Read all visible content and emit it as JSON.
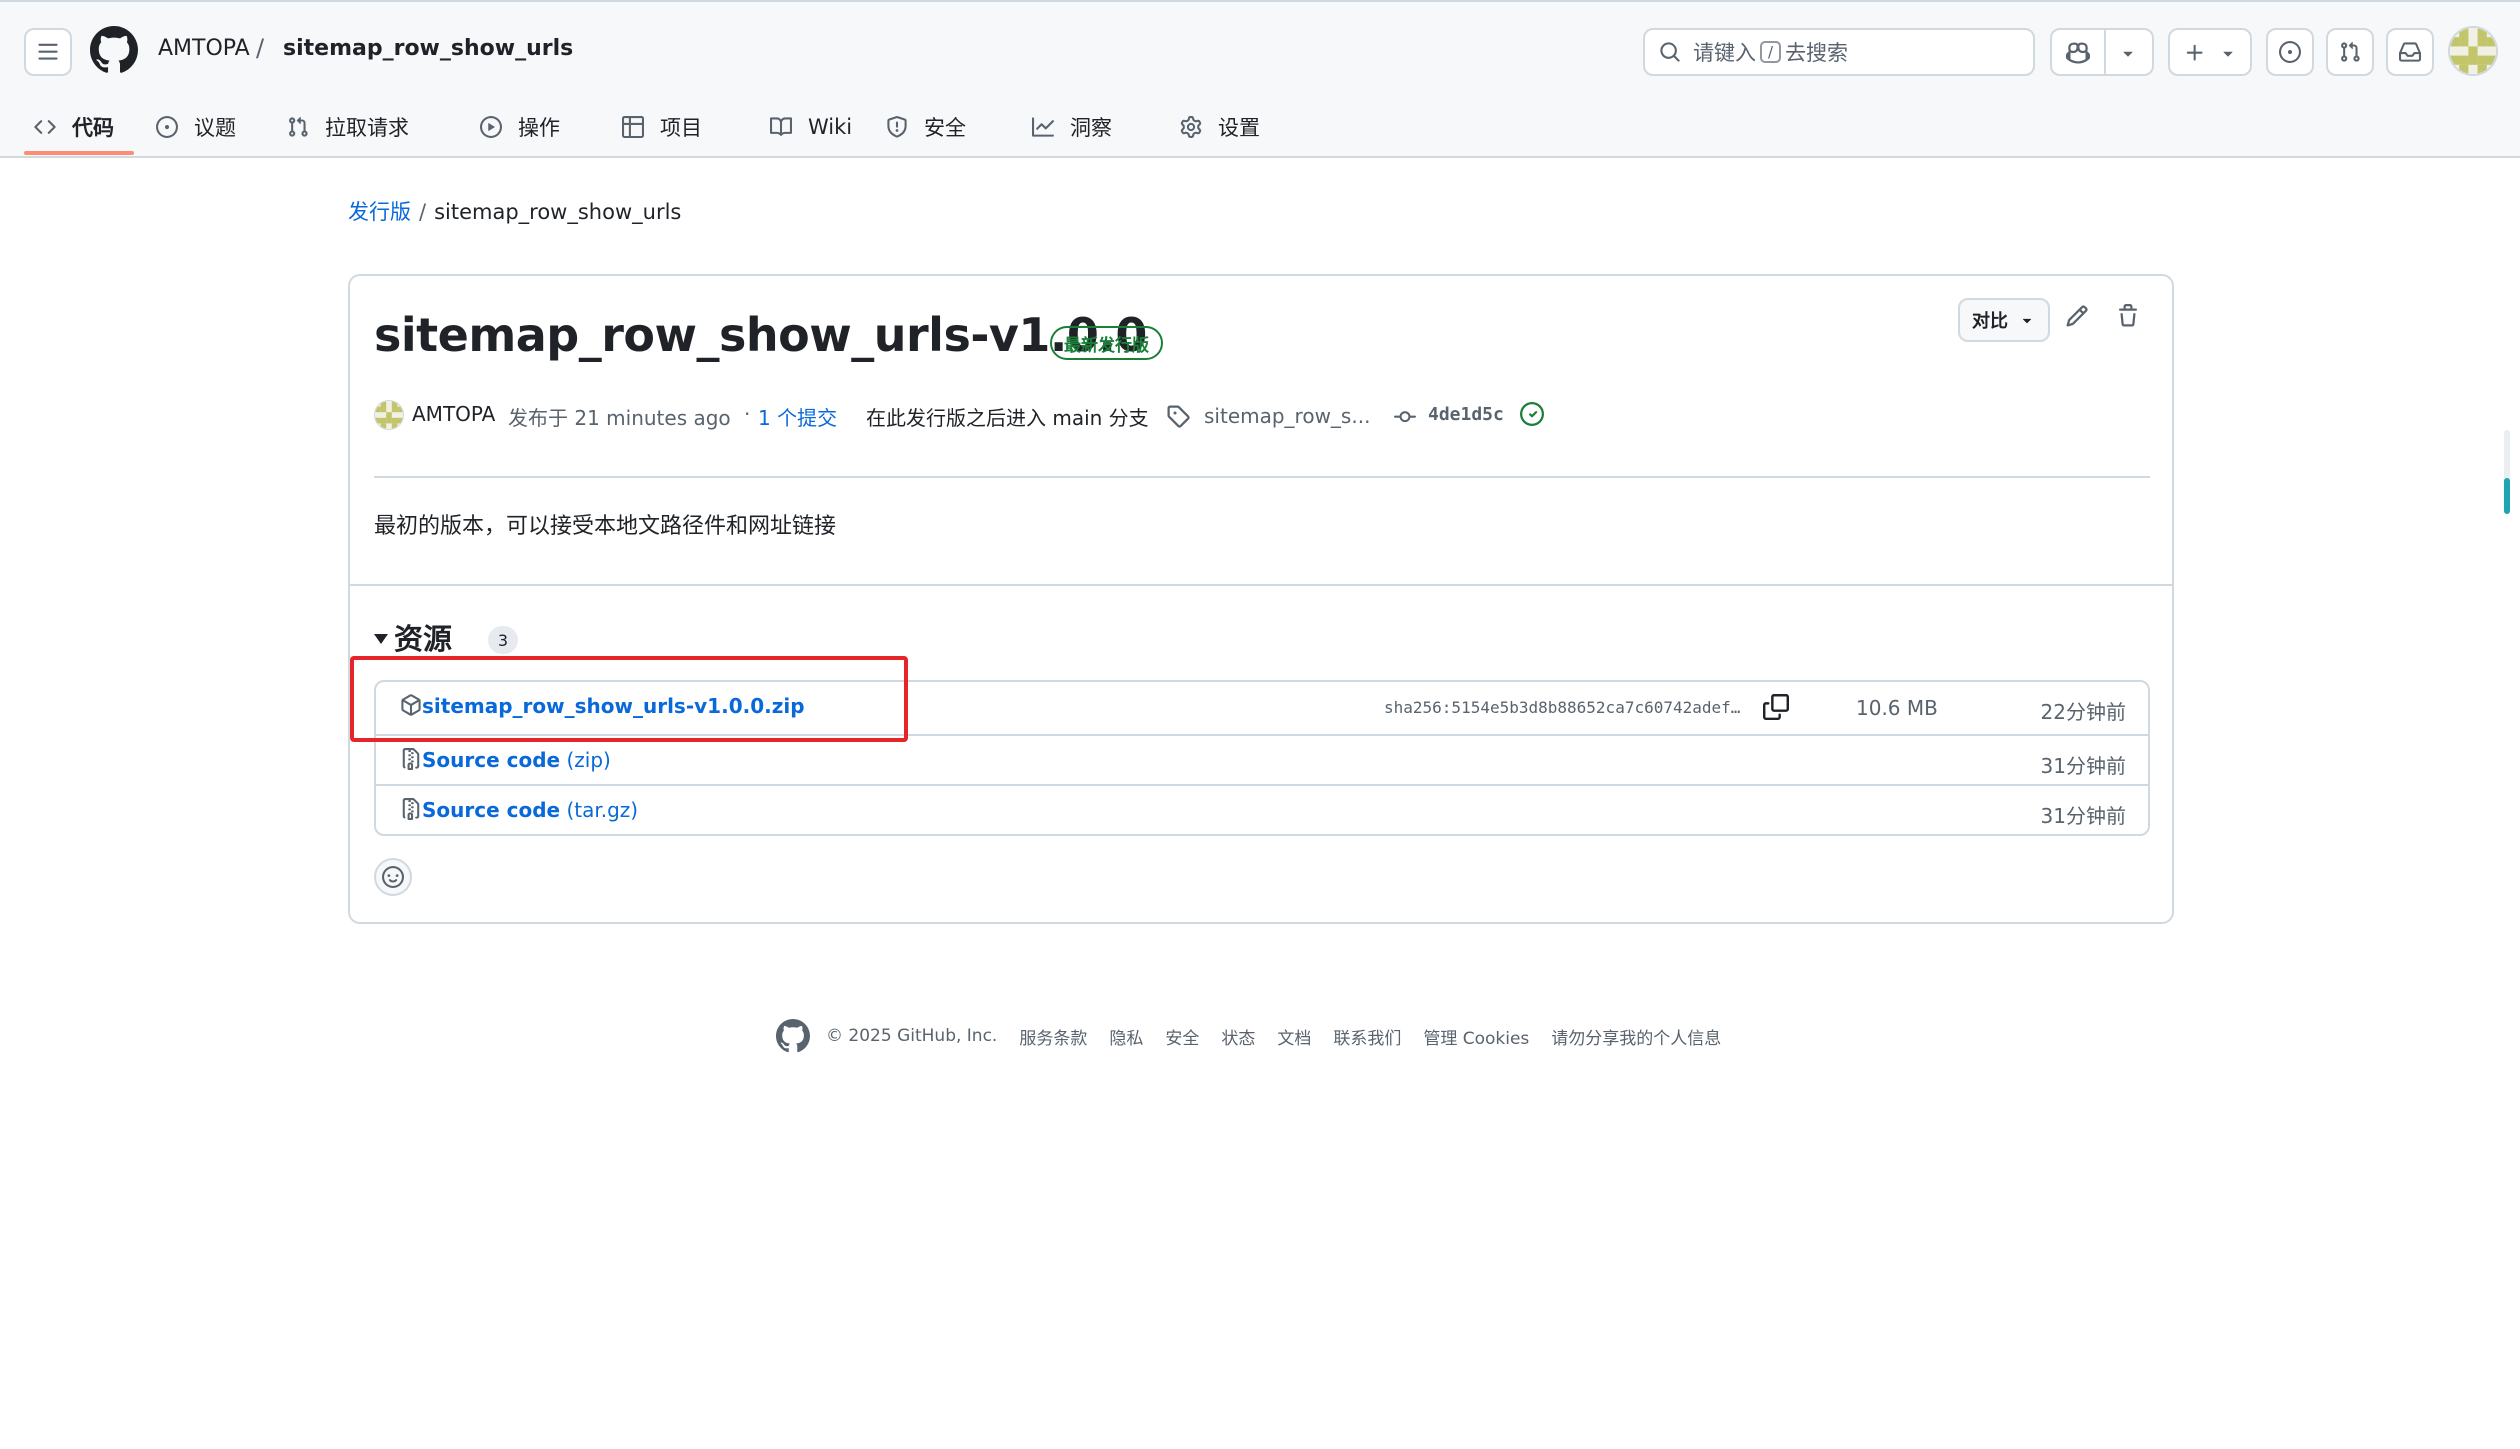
{
  "header": {
    "owner": "AMTOPA",
    "slash": "/",
    "repo": "sitemap_row_show_urls",
    "search": {
      "prefix": "请键入",
      "kbd": "/",
      "suffix": "去搜索"
    }
  },
  "tabs": [
    {
      "label": "代码",
      "icon": "code-icon",
      "active": true
    },
    {
      "label": "议题",
      "icon": "issue-opened-icon"
    },
    {
      "label": "拉取请求",
      "icon": "git-pull-request-icon"
    },
    {
      "label": "操作",
      "icon": "play-icon"
    },
    {
      "label": "项目",
      "icon": "table-icon"
    },
    {
      "label": "Wiki",
      "icon": "book-icon"
    },
    {
      "label": "安全",
      "icon": "shield-icon"
    },
    {
      "label": "洞察",
      "icon": "graph-icon"
    },
    {
      "label": "设置",
      "icon": "gear-icon"
    }
  ],
  "breadcrumb": {
    "releases": "发行版",
    "sep": "/",
    "current": "sitemap_row_show_urls"
  },
  "release": {
    "title": "sitemap_row_show_urls-v1.0.0",
    "badge": "最新发行版",
    "compare": "对比",
    "author": "AMTOPA",
    "published": "发布于 21 minutes ago",
    "dot": "·",
    "commits_link": "1 个提交",
    "commits_rest": "在此发行版之后进入 main 分支",
    "tag": "sitemap_row_s...",
    "commit_sha": "4de1d5c",
    "body": "最初的版本，可以接受本地文路径件和网址链接"
  },
  "assets": {
    "heading": "资源",
    "count": "3",
    "rows": [
      {
        "name": "sitemap_row_show_urls-v1.0.0.zip",
        "suffix": "",
        "hash": "sha256:5154e5b3d8b88652ca7c60742adef…",
        "size": "10.6 MB",
        "time": "22分钟前"
      },
      {
        "name": "Source code",
        "suffix": " (zip)",
        "hash": "",
        "size": "",
        "time": "31分钟前"
      },
      {
        "name": "Source code",
        "suffix": " (tar.gz)",
        "hash": "",
        "size": "",
        "time": "31分钟前"
      }
    ]
  },
  "footer": {
    "copyright": "© 2025 GitHub, Inc.",
    "links": [
      "服务条款",
      "隐私",
      "安全",
      "状态",
      "文档",
      "联系我们",
      "管理 Cookies",
      "请勿分享我的个人信息"
    ]
  },
  "colors": {
    "accent": "#0969da",
    "latest": "#1a7f37",
    "highlight": "#e5252a",
    "tab_underline": "#fd8c73"
  }
}
